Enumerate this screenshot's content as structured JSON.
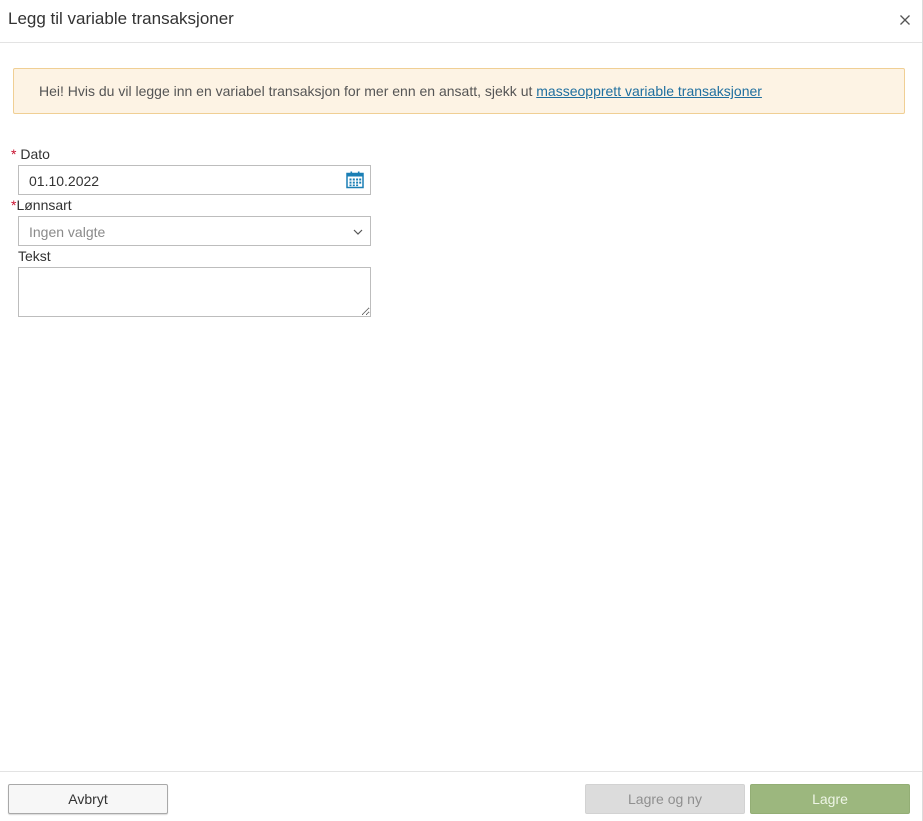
{
  "dialog": {
    "title": "Legg til variable transaksjoner"
  },
  "alert": {
    "text": "Hei! Hvis du vil legge inn en variabel transaksjon for mer enn en ansatt, sjekk ut ",
    "link_text": "masseopprett variable transaksjoner"
  },
  "form": {
    "date": {
      "required_mark": "*",
      "label": "Dato",
      "value": "01.10.2022",
      "icon": "calendar-icon"
    },
    "pay_type": {
      "required_mark": "*",
      "label": "Lønnsart",
      "value": "Ingen valgte",
      "icon": "chevron-down-icon"
    },
    "text": {
      "label": "Tekst",
      "value": ""
    }
  },
  "footer": {
    "cancel_label": "Avbryt",
    "save_new_label": "Lagre og ny",
    "save_label": "Lagre"
  },
  "colors": {
    "alert_bg": "#fdf3e4",
    "alert_border": "#f0cf94",
    "link": "#1f6f9f",
    "required": "#c8102e",
    "calendar_icon": "#1a7fb5",
    "save_button": "#9cb77e",
    "save_new_button": "#dcdcdc"
  }
}
